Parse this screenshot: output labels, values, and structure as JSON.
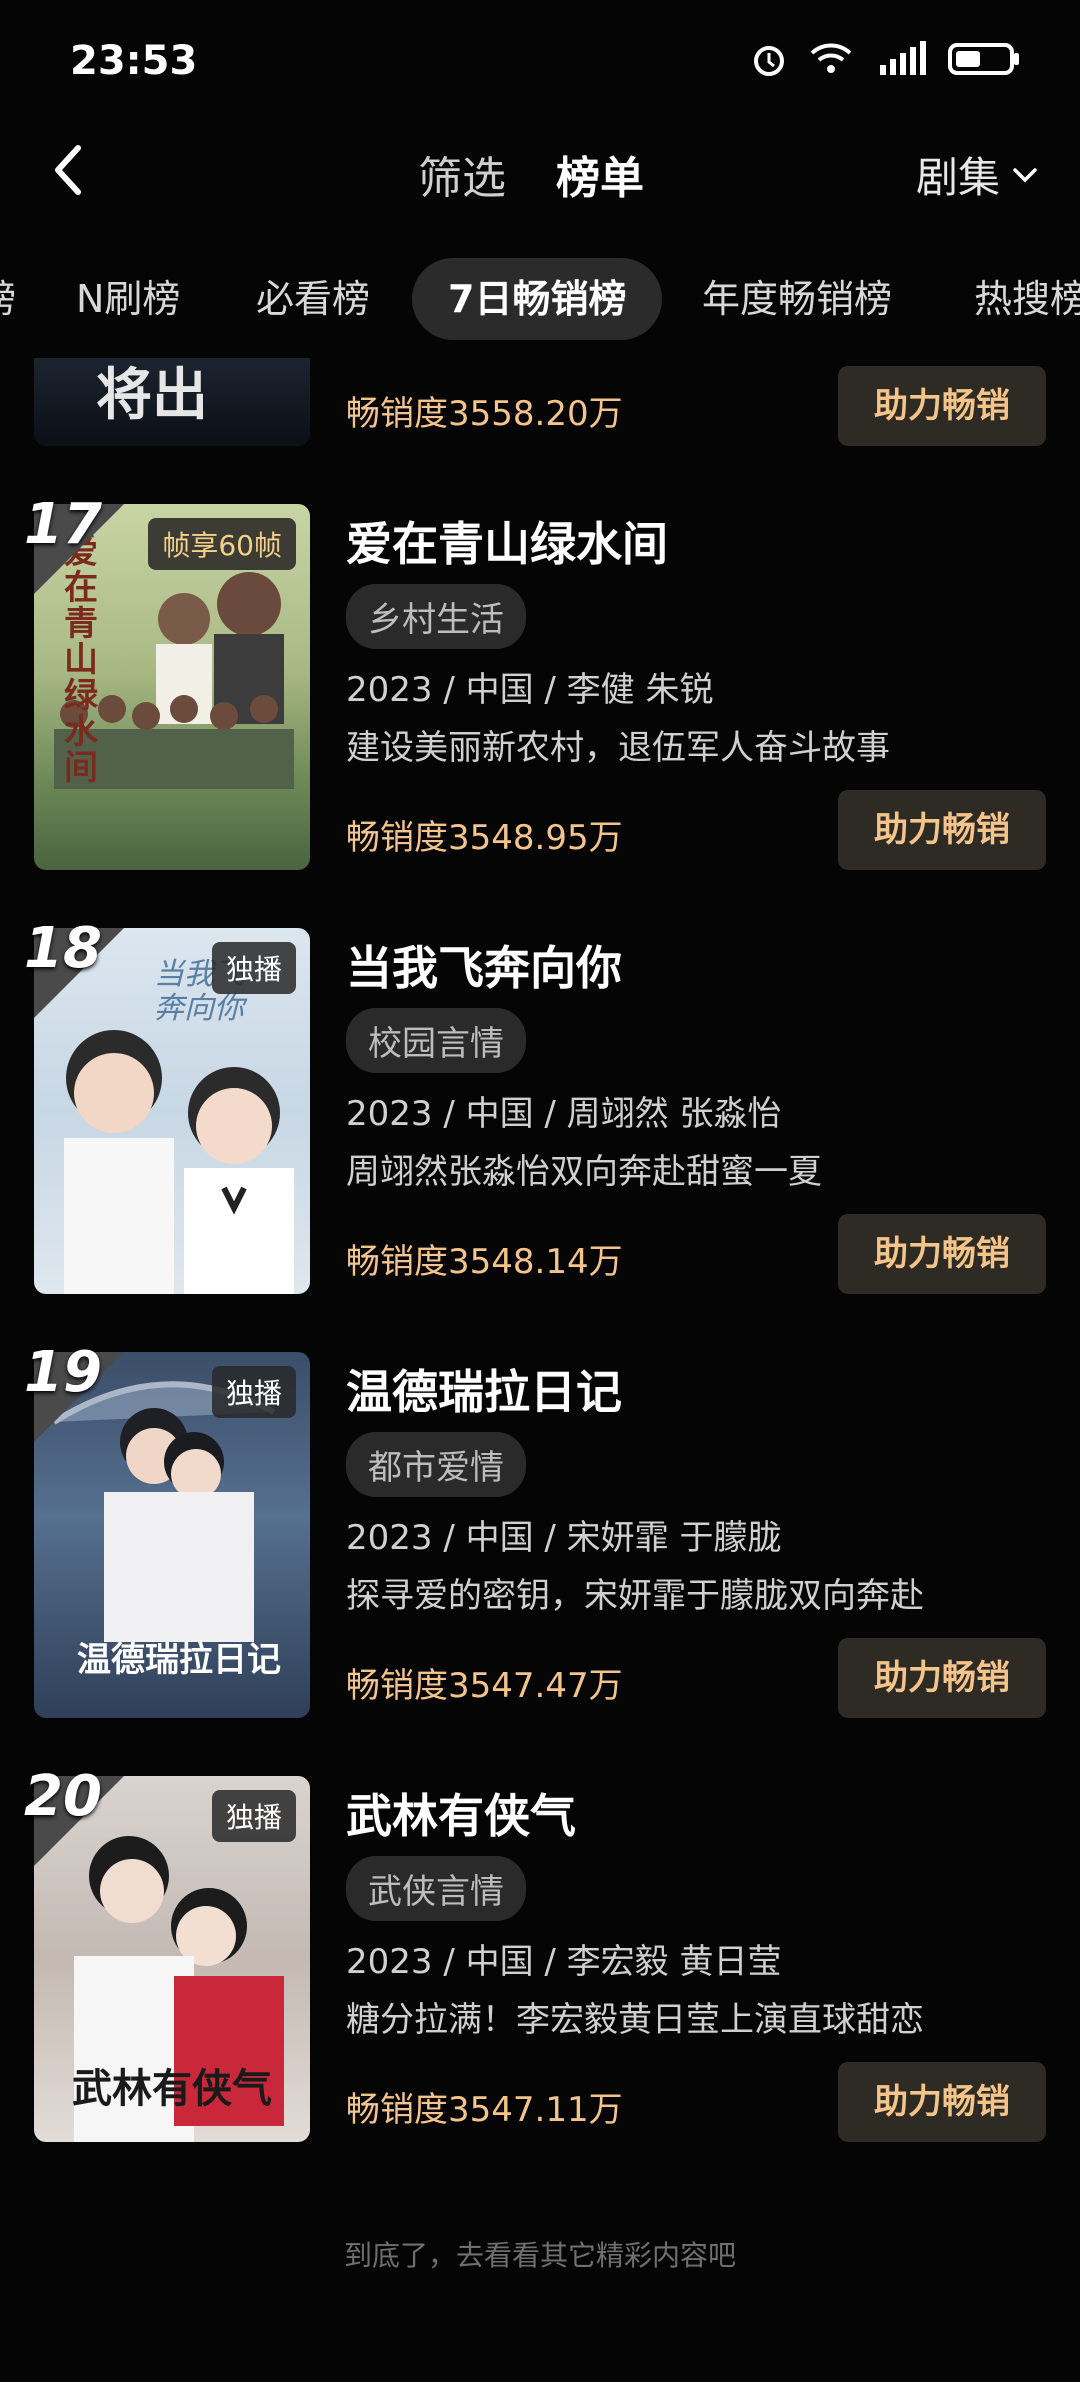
{
  "status": {
    "time": "23:53"
  },
  "nav": {
    "filter": "筛选",
    "rank": "榜单",
    "category": "剧集"
  },
  "cats": [
    "榜",
    "N刷榜",
    "必看榜",
    "7日畅销榜",
    "年度畅销榜",
    "热搜榜"
  ],
  "partial": {
    "poster_text": "将出",
    "sales": "畅销度3558.20万",
    "boost": "助力畅销"
  },
  "items": [
    {
      "rank": "17",
      "badge": "帧享60帧",
      "title": "爱在青山绿水间",
      "genre": "乡村生活",
      "meta": "2023 / 中国 / 李健 朱锐",
      "desc": "建设美丽新农村，退伍军人奋斗故事",
      "sales": "畅销度3548.95万",
      "boost": "助力畅销",
      "poster_text": "爱在青山绿水间"
    },
    {
      "rank": "18",
      "badge": "独播",
      "title": "当我飞奔向你",
      "genre": "校园言情",
      "meta": "2023 / 中国 / 周翊然 张淼怡",
      "desc": "周翊然张淼怡双向奔赴甜蜜一夏",
      "sales": "畅销度3548.14万",
      "boost": "助力畅销",
      "poster_text": "当我飞奔向你"
    },
    {
      "rank": "19",
      "badge": "独播",
      "title": "温德瑞拉日记",
      "genre": "都市爱情",
      "meta": "2023 / 中国 / 宋妍霏 于朦胧",
      "desc": "探寻爱的密钥，宋妍霏于朦胧双向奔赴",
      "sales": "畅销度3547.47万",
      "boost": "助力畅销",
      "poster_text": "温德瑞拉日记"
    },
    {
      "rank": "20",
      "badge": "独播",
      "title": "武林有侠气",
      "genre": "武侠言情",
      "meta": "2023 / 中国 / 李宏毅 黄日莹",
      "desc": "糖分拉满！李宏毅黄日莹上演直球甜恋",
      "sales": "畅销度3547.11万",
      "boost": "助力畅销",
      "poster_text": "武林有侠气"
    }
  ],
  "footer": "到底了，去看看其它精彩内容吧"
}
